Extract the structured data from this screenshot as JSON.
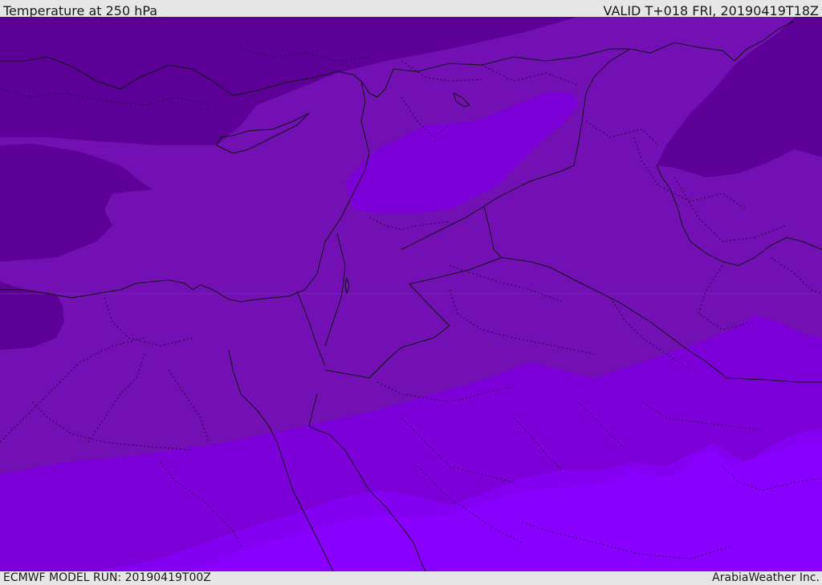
{
  "header": {
    "title": "Temperature at 250 hPa",
    "valid_time": "VALID T+018 FRI, 20190419T18Z"
  },
  "footer": {
    "model_run": "ECMWF MODEL RUN: 20190419T00Z",
    "credit": "ArabiaWeather Inc."
  },
  "map": {
    "variable": "temperature",
    "pressure_level_hpa": 250,
    "colors": {
      "darkest": "#5c0097",
      "dark": "#6a00a6",
      "mid": "#7210b4",
      "medium_bright": "#7c00d8",
      "bright": "#8400f0",
      "brightest": "#8a00ff"
    },
    "borders_color": "#111111"
  }
}
